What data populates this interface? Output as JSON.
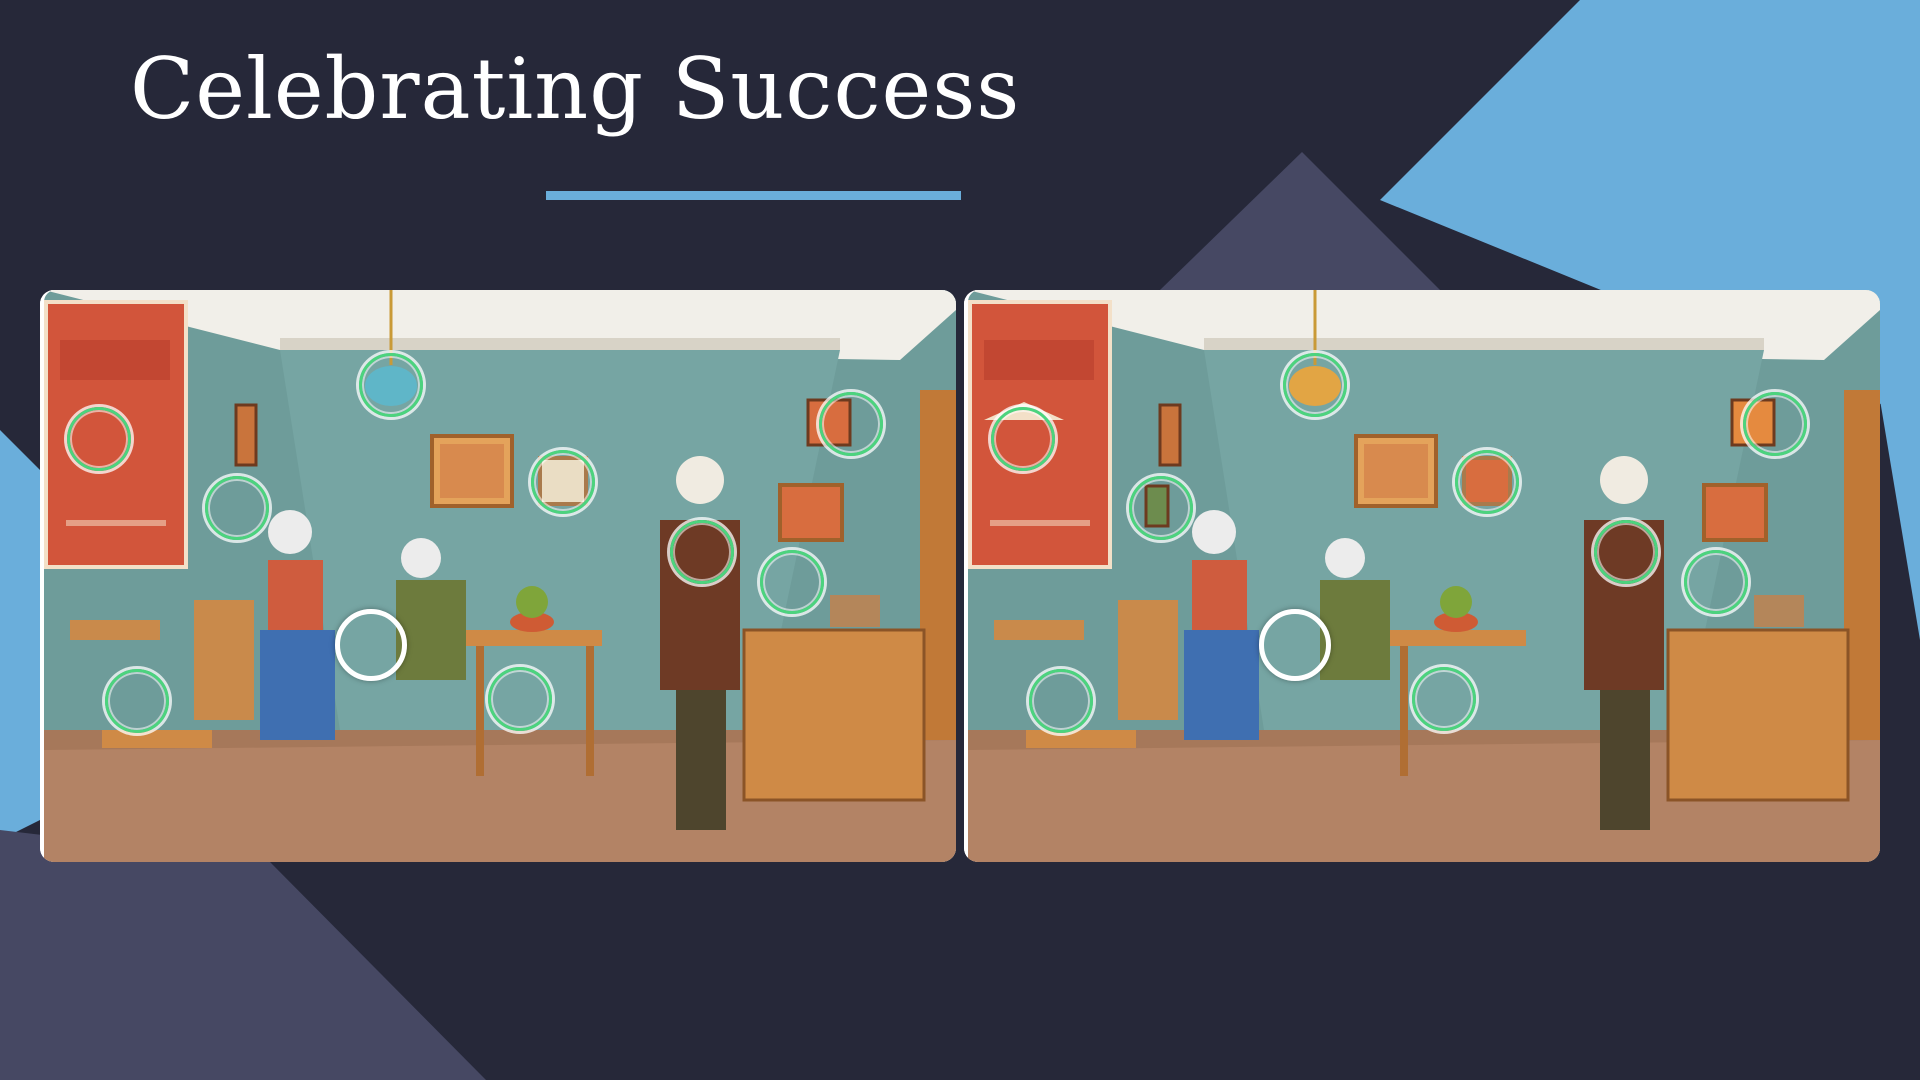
{
  "slide": {
    "title": "Celebrating Success"
  },
  "colors": {
    "background": "#262839",
    "accent_blue": "#6aaedb",
    "accent_purple": "#464863",
    "found_marker": "#4cd37e",
    "wall": "#6e9c9a",
    "floor": "#a6785a"
  },
  "game": {
    "type": "spot-the-difference",
    "panels": [
      {
        "name": "left",
        "lamp_color": "#5fb6c8",
        "markers": [
          "lamp",
          "poster-mountain",
          "empty-wall-spot",
          "small-frame",
          "right-frame",
          "man-lapel",
          "bench-box",
          "chair-seat",
          "table-leg",
          "cursor-circle"
        ]
      },
      {
        "name": "right",
        "lamp_color": "#e2a544",
        "markers": [
          "lamp",
          "poster-mountain",
          "wall-frame",
          "small-frame",
          "right-frame",
          "man-lapel",
          "bench-box",
          "chair-seat",
          "table-leg",
          "cursor-circle"
        ]
      }
    ]
  }
}
